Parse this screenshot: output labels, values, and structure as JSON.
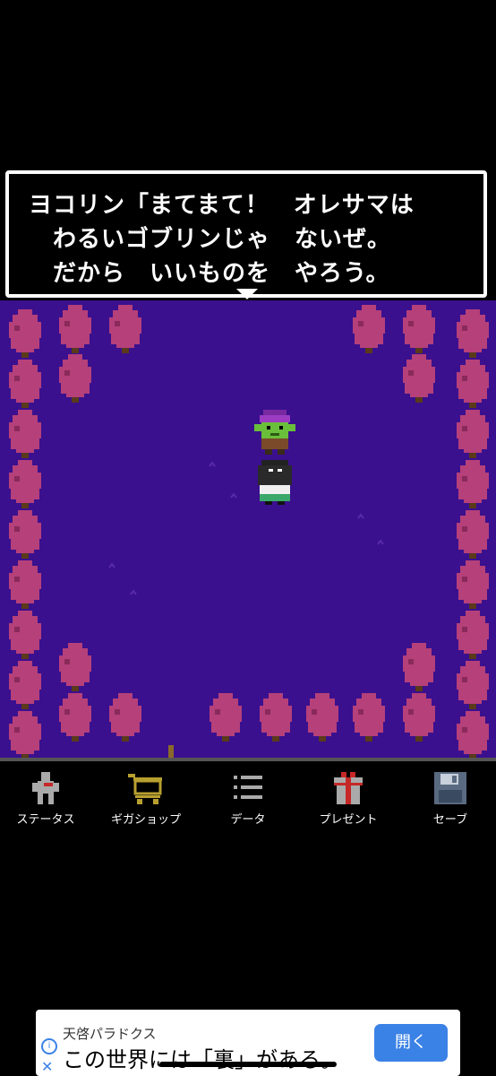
{
  "dialog": {
    "lines": [
      "ヨコリン「まてまて！　オレサマは",
      "　わるいゴブリンじゃ　ないぜ。",
      "　だから　いいものを　やろう。"
    ]
  },
  "menu": {
    "items": [
      {
        "label": "ステータス",
        "icon": "status-icon"
      },
      {
        "label": "ギガショップ",
        "icon": "shopping-cart-icon"
      },
      {
        "label": "データ",
        "icon": "list-icon"
      },
      {
        "label": "プレゼント",
        "icon": "gift-icon"
      },
      {
        "label": "セーブ",
        "icon": "save-icon"
      }
    ]
  },
  "ad": {
    "advertiser": "天啓パラドクス",
    "headline": "この世界には「裏」がある。",
    "button_label": "開く",
    "info_glyph": "i",
    "close_glyph": "✕"
  },
  "colors": {
    "field": "#3a108e",
    "tree": "#b5407a",
    "accent_button": "#3b82e6"
  }
}
